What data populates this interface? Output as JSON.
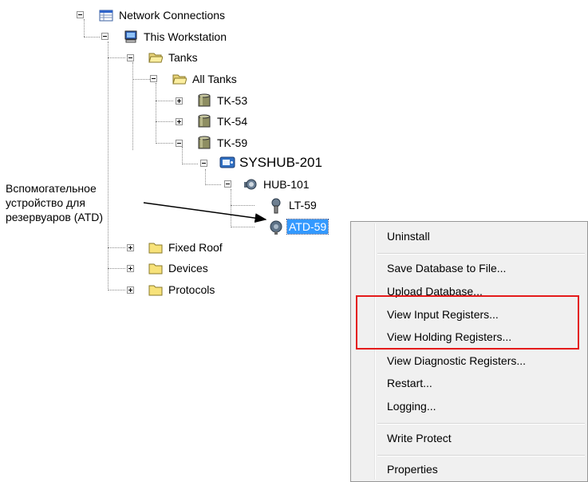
{
  "tree": {
    "network_connections": "Network Connections",
    "this_workstation": "This Workstation",
    "tanks": "Tanks",
    "all_tanks": "All Tanks",
    "tk53": "TK-53",
    "tk54": "TK-54",
    "tk59": "TK-59",
    "syshub": "SYSHUB-201",
    "hub101": "HUB-101",
    "lt59": "LT-59",
    "atd59": "ATD-59",
    "fixed_roof": "Fixed Roof",
    "devices": "Devices",
    "protocols": "Protocols"
  },
  "callout": {
    "line1": "Вспомогательное",
    "line2": "устройство для",
    "line3": "резервуаров (ATD)"
  },
  "context_menu": {
    "uninstall": "Uninstall",
    "save_db": "Save Database to File...",
    "upload_db": "Upload Database...",
    "view_input": "View Input Registers...",
    "view_holding": "View Holding Registers...",
    "view_diag": "View Diagnostic Registers...",
    "restart": "Restart...",
    "logging": "Logging...",
    "write_protect": "Write Protect",
    "properties": "Properties"
  },
  "colors": {
    "selection": "#3399ff",
    "highlight_box": "#e41b1b",
    "menu_bg": "#f0f0f0"
  }
}
